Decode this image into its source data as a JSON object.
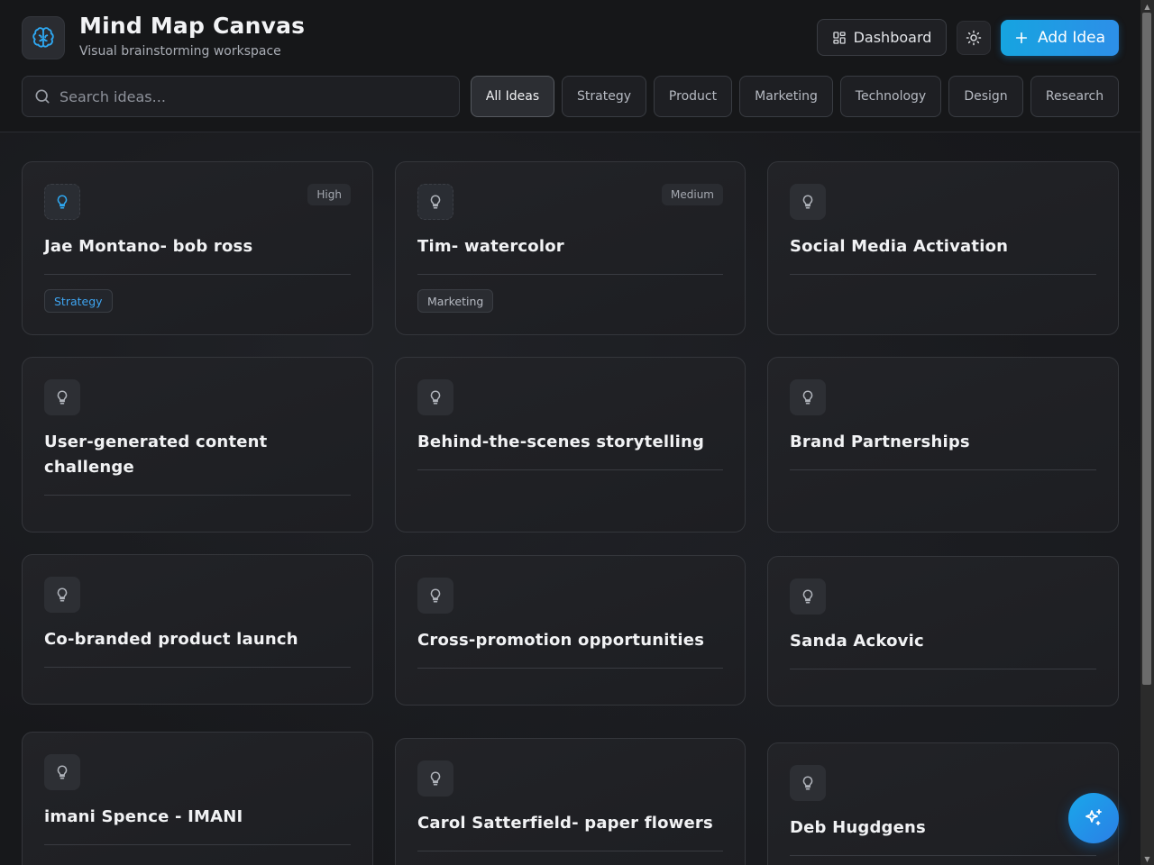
{
  "header": {
    "title": "Mind Map Canvas",
    "subtitle": "Visual brainstorming workspace",
    "logo_icon": "brain-icon",
    "dashboard_label": "Dashboard",
    "theme_icon": "sun-icon",
    "add_label": "Add Idea"
  },
  "search": {
    "placeholder": "Search ideas...",
    "value": ""
  },
  "filters": [
    {
      "label": "All Ideas",
      "active": true
    },
    {
      "label": "Strategy",
      "active": false
    },
    {
      "label": "Product",
      "active": false
    },
    {
      "label": "Marketing",
      "active": false
    },
    {
      "label": "Technology",
      "active": false
    },
    {
      "label": "Design",
      "active": false
    },
    {
      "label": "Research",
      "active": false
    }
  ],
  "cards": [
    {
      "title": "Jae Montano- bob ross",
      "priority": "High",
      "tag": "Strategy"
    },
    {
      "title": "Tim- watercolor",
      "priority": "Medium",
      "tag": "Marketing"
    },
    {
      "title": "Social Media Activation",
      "priority": "",
      "tag": ""
    },
    {
      "title": "User-generated content challenge",
      "priority": "",
      "tag": ""
    },
    {
      "title": "Behind-the-scenes storytelling",
      "priority": "",
      "tag": ""
    },
    {
      "title": "Brand Partnerships",
      "priority": "",
      "tag": ""
    },
    {
      "title": "Co-branded product launch",
      "priority": "",
      "tag": ""
    },
    {
      "title": "Cross-promotion opportunities",
      "priority": "",
      "tag": ""
    },
    {
      "title": "Sanda Ackovic",
      "priority": "",
      "tag": ""
    },
    {
      "title": "imani Spence - IMANI",
      "priority": "",
      "tag": ""
    },
    {
      "title": "Carol Satterfield- paper flowers",
      "priority": "",
      "tag": ""
    },
    {
      "title": "Deb Hugdgens",
      "priority": "",
      "tag": ""
    }
  ],
  "fab_icon": "sparkles-icon",
  "colors": {
    "accent": "#1aa3e6",
    "tag_strategy": "#3ea4f0",
    "background": "#17181b"
  }
}
